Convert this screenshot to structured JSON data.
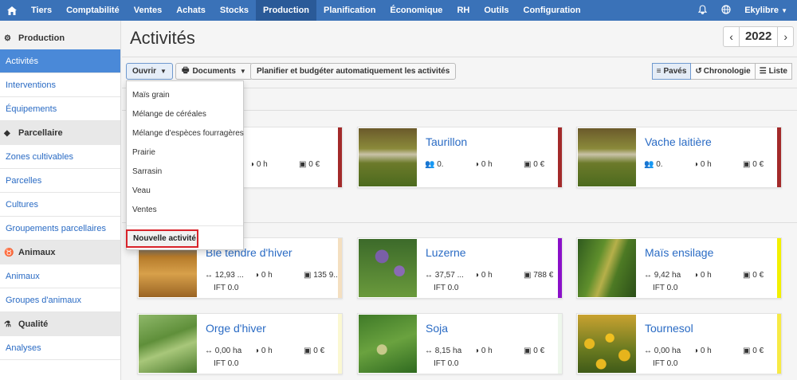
{
  "nav": {
    "items": [
      "Tiers",
      "Comptabilité",
      "Ventes",
      "Achats",
      "Stocks",
      "Production",
      "Planification",
      "Économique",
      "RH",
      "Outils",
      "Configuration"
    ],
    "active": "Production",
    "user": "Ekylibre"
  },
  "sidebar": {
    "sections": [
      {
        "title": "Production",
        "items": [
          "Activités",
          "Interventions",
          "Équipements"
        ]
      },
      {
        "title": "Parcellaire",
        "items": [
          "Zones cultivables",
          "Parcelles",
          "Cultures",
          "Groupements parcellaires"
        ]
      },
      {
        "title": "Animaux",
        "items": [
          "Animaux",
          "Groupes d'animaux"
        ]
      },
      {
        "title": "Qualité",
        "items": [
          "Analyses"
        ]
      }
    ]
  },
  "page": {
    "title": "Activités",
    "year": "2022"
  },
  "toolbar": {
    "open_label": "Ouvrir",
    "documents_label": "Documents",
    "plan_label": "Planifier et budgéter automatiquement les activités",
    "view_tiles": "Pavés",
    "view_timeline": "Chronologie",
    "view_list": "Liste"
  },
  "dropdown": {
    "items": [
      "Maïs grain",
      "Mélange de céréales",
      "Mélange d'espèces fourragères",
      "Prairie",
      "Sarrasin",
      "Veau",
      "Ventes"
    ],
    "new_activity": "Nouvelle activité"
  },
  "cards": [
    {
      "name": "",
      "s1": "0 h",
      "s2": "0 €",
      "s3": "",
      "ift": "",
      "bar": "#a32a2a"
    },
    {
      "name": "Taurillon",
      "s1": "0.",
      "s2": "0 h",
      "s3": "0 €",
      "ift": "",
      "bar": "#a32a2a"
    },
    {
      "name": "Vache laitière",
      "s1": "0.",
      "s2": "0 h",
      "s3": "0 €",
      "ift": "",
      "bar": "#a32a2a"
    },
    {
      "name": "Blé tendre d'hiver",
      "s1": "12,93 ...",
      "s2": "0 h",
      "s3": "135 9...",
      "ift": "IFT 0.0",
      "bar": "#f4dfc0"
    },
    {
      "name": "Luzerne",
      "s1": "37,57 ...",
      "s2": "0 h",
      "s3": "788 €",
      "ift": "IFT 0.0",
      "bar": "#8a10c9"
    },
    {
      "name": "Maïs ensilage",
      "s1": "9,42 ha",
      "s2": "0 h",
      "s3": "0 €",
      "ift": "IFT 0.0",
      "bar": "#f2f000"
    },
    {
      "name": "Orge d'hiver",
      "s1": "0,00 ha",
      "s2": "0 h",
      "s3": "0 €",
      "ift": "IFT 0.0",
      "bar": "#fbf8d2"
    },
    {
      "name": "Soja",
      "s1": "8,15 ha",
      "s2": "0 h",
      "s3": "0 €",
      "ift": "IFT 0.0",
      "bar": "#eef7ec"
    },
    {
      "name": "Tournesol",
      "s1": "0,00 ha",
      "s2": "0 h",
      "s3": "0 €",
      "ift": "IFT 0.0",
      "bar": "#f7ea45"
    }
  ]
}
